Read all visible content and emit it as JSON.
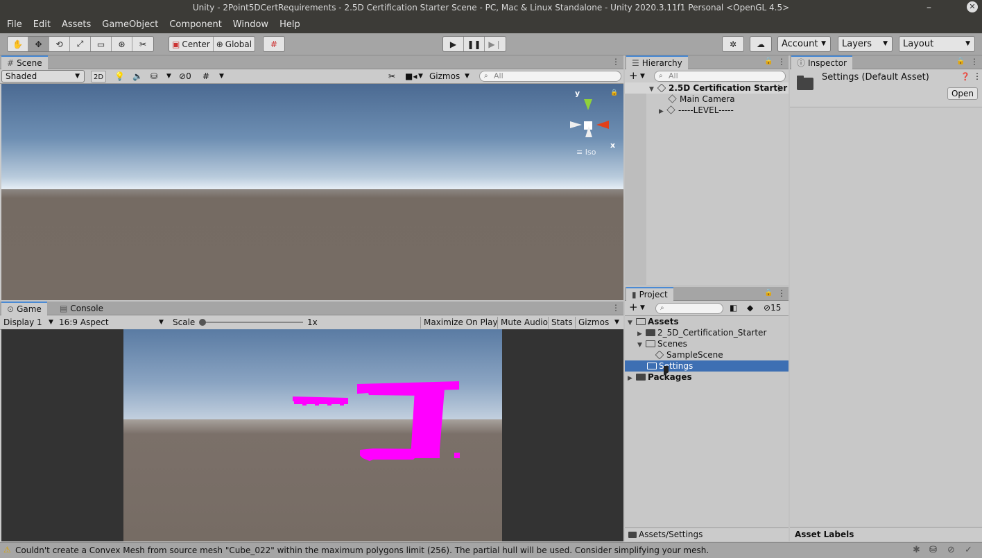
{
  "window": {
    "title": "Unity - 2Point5DCertRequirements - 2.5D Certification Starter Scene - PC, Mac & Linux Standalone - Unity 2020.3.11f1 Personal <OpenGL 4.5>"
  },
  "menu": [
    "File",
    "Edit",
    "Assets",
    "GameObject",
    "Component",
    "Window",
    "Help"
  ],
  "toolbar": {
    "center_label": "Center",
    "global_label": "Global",
    "account_label": "Account",
    "layers_label": "Layers",
    "layout_label": "Layout"
  },
  "scene": {
    "tab_label": "Scene",
    "shading_mode": "Shaded",
    "mode_2d": "2D",
    "hidden_count": "0",
    "gizmos_label": "Gizmos",
    "search_placeholder": "All",
    "gizmo_y": "y",
    "gizmo_x": "x",
    "projection": "Iso"
  },
  "game": {
    "tab_label": "Game",
    "console_tab_label": "Console",
    "display": "Display 1",
    "aspect": "16:9 Aspect",
    "scale_label": "Scale",
    "scale_value": "1x",
    "maximize_label": "Maximize On Play",
    "mute_label": "Mute Audio",
    "stats_label": "Stats",
    "gizmos_label": "Gizmos"
  },
  "hierarchy": {
    "tab_label": "Hierarchy",
    "search_placeholder": "All",
    "items": [
      {
        "label": "2.5D Certification Starter"
      },
      {
        "label": "Main Camera"
      },
      {
        "label": "-----LEVEL-----"
      }
    ]
  },
  "project": {
    "tab_label": "Project",
    "hidden_count": "15",
    "items": [
      {
        "label": "Assets"
      },
      {
        "label": "2_5D_Certification_Starter"
      },
      {
        "label": "Scenes"
      },
      {
        "label": "SampleScene"
      },
      {
        "label": "Settings"
      },
      {
        "label": "Packages"
      }
    ],
    "path": "Assets/Settings"
  },
  "inspector": {
    "tab_label": "Inspector",
    "asset_title": "Settings (Default Asset)",
    "open_label": "Open",
    "asset_labels": "Asset Labels"
  },
  "status": {
    "message": "Couldn't create a Convex Mesh from source mesh \"Cube_022\" within the maximum polygons limit (256). The partial hull will be used. Consider simplifying your mesh."
  },
  "colors": {
    "selection": "#3d6fb3",
    "sky_top": "#4a6890",
    "ground": "#756a62",
    "missing_material": "#ff00ff"
  }
}
